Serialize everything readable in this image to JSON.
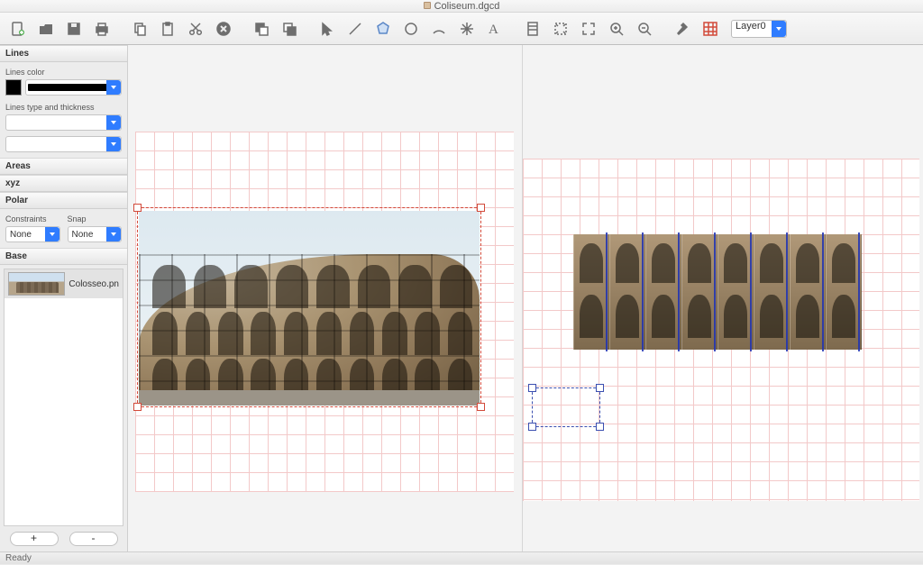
{
  "window": {
    "title": "Coliseum.dgcd"
  },
  "toolbar": {
    "layer_value": "Layer0",
    "tools": [
      "new-doc",
      "open",
      "save",
      "print",
      "sep",
      "copy",
      "paste",
      "cut",
      "delete",
      "sep",
      "send-back",
      "bring-front",
      "sep",
      "pointer",
      "line",
      "polygon",
      "circle",
      "arc",
      "star",
      "text",
      "sep",
      "sheet",
      "fit-page",
      "fit-screen",
      "zoom-in",
      "zoom-out",
      "sep",
      "hammer",
      "grid-toggle"
    ]
  },
  "sidebar": {
    "panels": {
      "lines": {
        "title": "Lines",
        "color_label": "Lines color",
        "type_label": "Lines type and thickness"
      },
      "areas": {
        "title": "Areas"
      },
      "xyz": {
        "title": "xyz"
      },
      "polar": {
        "title": "Polar",
        "constraints_label": "Constraints",
        "snap_label": "Snap",
        "constraints_value": "None",
        "snap_value": "None"
      },
      "base": {
        "title": "Base",
        "items": [
          {
            "name": "Colosseo.pn"
          }
        ],
        "add_label": "+",
        "remove_label": "-"
      }
    }
  },
  "status": {
    "text": "Ready"
  }
}
